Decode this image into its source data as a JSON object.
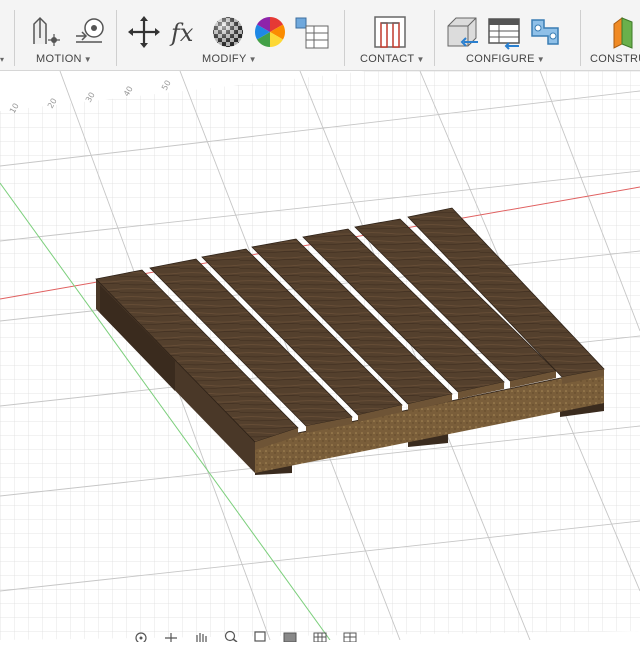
{
  "toolbar": {
    "groups": [
      {
        "label": "MOTION",
        "icons": [
          "joint-icon",
          "motion-link-icon"
        ]
      },
      {
        "label": "MODIFY",
        "icons": [
          "move-copy-icon",
          "parameters-fx-icon",
          "appearance-icon",
          "color-wheel-icon",
          "change-parameters-icon"
        ]
      },
      {
        "label": "CONTACT",
        "icons": [
          "contact-sets-icon"
        ]
      },
      {
        "label": "CONFIGURE",
        "icons": [
          "create-configuration-icon",
          "configuration-table-icon",
          "configuration-rule-icon"
        ]
      },
      {
        "label": "CONSTRU",
        "icons": [
          "construct-plane-icon"
        ]
      }
    ]
  },
  "ruler_ticks": [
    "10",
    "20",
    "30",
    "40",
    "50"
  ],
  "viewport": {
    "model": "wooden-pallet",
    "axis_colors": {
      "x": "#e06060",
      "y": "#7ccf7c"
    },
    "grid_color": "#d4d4d4",
    "wood_color": "#4d3a2a"
  },
  "bottom_nav": {
    "icons": [
      "orbit-icon",
      "pan-icon",
      "hand-icon",
      "zoom-icon",
      "zoom-window-icon",
      "display-settings-icon",
      "grid-settings-icon",
      "viewport-layout-icon"
    ]
  }
}
